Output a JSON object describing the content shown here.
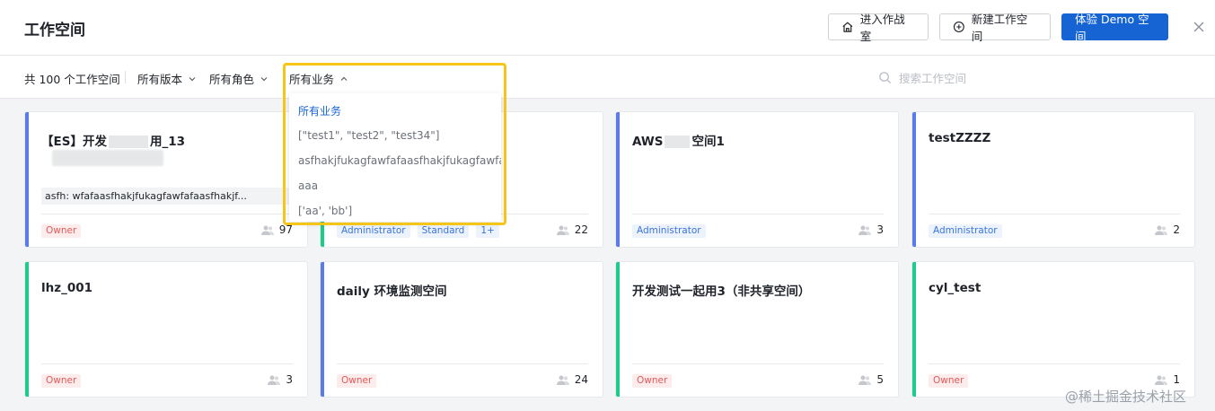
{
  "header": {
    "title": "工作空间",
    "warroom_label": "进入作战室",
    "new_label": "新建工作空间",
    "demo_label": "体验 Demo 空间"
  },
  "filters": {
    "total": "共 100 个工作空间",
    "version": "所有版本",
    "role": "所有角色",
    "business": "所有业务",
    "search_placeholder": "搜索工作空间"
  },
  "dropdown": {
    "items": [
      "所有业务",
      "[\"test1\", \"test2\", \"test34\"]",
      "asfhakjfukagfawfafaasfhakjfukagfawfa...",
      "aaa",
      "['aa', 'bb']"
    ]
  },
  "cards": [
    {
      "name": "【ES】开发",
      "name_tail": "用_13",
      "desc": "asfh: wfafaasfhakjfukagfawfafaasfhakjf...",
      "tags": [
        "Owner"
      ],
      "count": "97",
      "accent": "#5b7bea"
    },
    {
      "name": "",
      "tags": [
        "Administrator",
        "Standard",
        "1+"
      ],
      "count": "22",
      "accent": "#1ecb8a"
    },
    {
      "name": "AWS",
      "name_tail": "空间1",
      "tags": [
        "Administrator"
      ],
      "count": "3",
      "accent": "#5b7bea"
    },
    {
      "name": "testZZZZ",
      "tags": [
        "Administrator"
      ],
      "count": "2",
      "accent": "#5b7bea"
    },
    {
      "name": "lhz_001",
      "tags": [
        "Owner"
      ],
      "count": "3",
      "accent": "#1ecb8a"
    },
    {
      "name": "daily 环境监测空间",
      "tags": [
        "Owner"
      ],
      "count": "24",
      "accent": "#5b7bea"
    },
    {
      "name": "开发测试一起用3（非共享空间）",
      "tags": [
        "Owner"
      ],
      "count": "5",
      "accent": "#1ecb8a"
    },
    {
      "name": "cyl_test",
      "tags": [
        "Owner"
      ],
      "count": "1",
      "accent": "#1ecb8a"
    }
  ],
  "watermark": "@稀土掘金技术社区",
  "colors": {
    "primary": "#1664d3",
    "highlight": "#f5c518",
    "owner_tag": "#e15a5a",
    "admin_tag": "#3b74d9"
  }
}
